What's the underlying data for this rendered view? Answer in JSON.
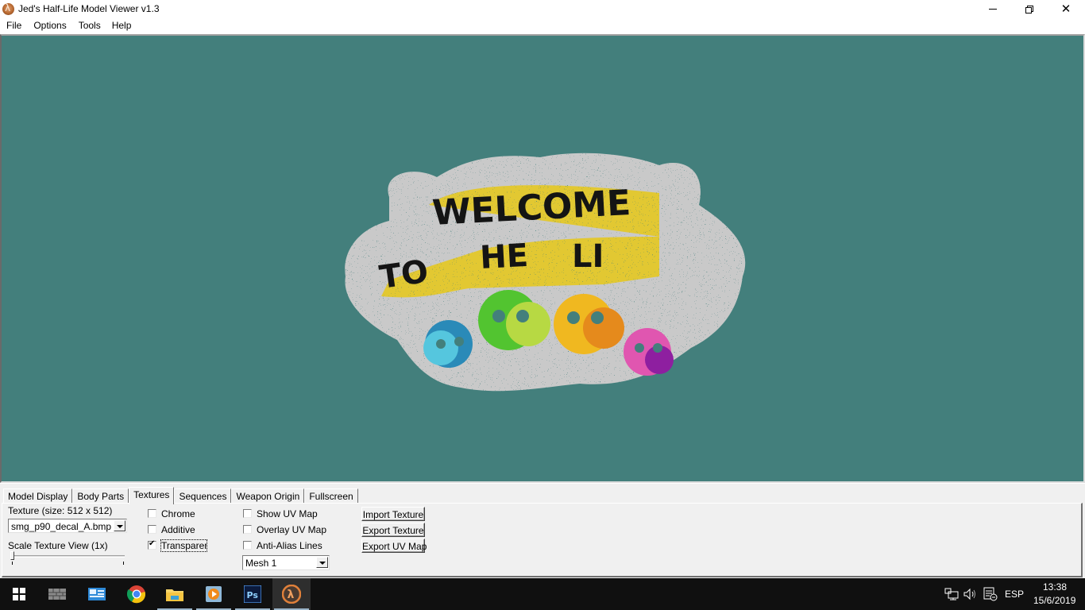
{
  "window": {
    "title": "Jed's Half-Life Model Viewer v1.3",
    "icon": "half-life-lambda-icon",
    "controls": {
      "minimize": "minimize-icon",
      "maximize": "restore-icon",
      "close": "close-icon",
      "close_glyph": "✕"
    }
  },
  "menu": {
    "items": [
      {
        "label": "File"
      },
      {
        "label": "Options"
      },
      {
        "label": "Tools"
      },
      {
        "label": "Help"
      }
    ]
  },
  "viewport": {
    "background_color": "#437f7c",
    "decal_text": "WELCOME TO THE CLIQUE"
  },
  "panel": {
    "tabs": [
      {
        "label": "Model Display",
        "active": false
      },
      {
        "label": "Body Parts",
        "active": false
      },
      {
        "label": "Textures",
        "active": true
      },
      {
        "label": "Sequences",
        "active": false
      },
      {
        "label": "Weapon Origin",
        "active": false
      },
      {
        "label": "Fullscreen",
        "active": false
      }
    ],
    "textures": {
      "texture_label": "Texture (size: 512 x 512)",
      "texture_select_value": "smg_p90_decal_A.bmp",
      "scale_label": "Scale Texture View (1x)",
      "scale_value": 1,
      "checkboxes_col1": [
        {
          "label": "Chrome",
          "checked": false
        },
        {
          "label": "Additive",
          "checked": false
        },
        {
          "label": "Transparent",
          "checked": true
        }
      ],
      "checkboxes_col2": [
        {
          "label": "Show UV Map",
          "checked": false
        },
        {
          "label": "Overlay UV Map",
          "checked": false
        },
        {
          "label": "Anti-Alias Lines",
          "checked": false
        }
      ],
      "mesh_select_value": "Mesh 1",
      "buttons": [
        {
          "label": "Import Texture"
        },
        {
          "label": "Export Texture"
        },
        {
          "label": "Export UV Map"
        }
      ]
    }
  },
  "taskbar": {
    "apps": [
      {
        "name": "start-button",
        "icon": "windows-logo-icon"
      },
      {
        "name": "task-view",
        "icon": "wall-icon"
      },
      {
        "name": "control-panel",
        "icon": "control-panel-icon"
      },
      {
        "name": "chrome",
        "icon": "chrome-icon"
      },
      {
        "name": "file-explorer",
        "icon": "folder-icon"
      },
      {
        "name": "media-player",
        "icon": "media-play-icon"
      },
      {
        "name": "photoshop",
        "icon": "photoshop-icon",
        "label": "Ps"
      },
      {
        "name": "hl-model-viewer",
        "icon": "half-life-lambda-icon",
        "active": true
      }
    ],
    "tray": {
      "language": "ESP",
      "time": "13:38",
      "date": "15/6/2019"
    }
  }
}
